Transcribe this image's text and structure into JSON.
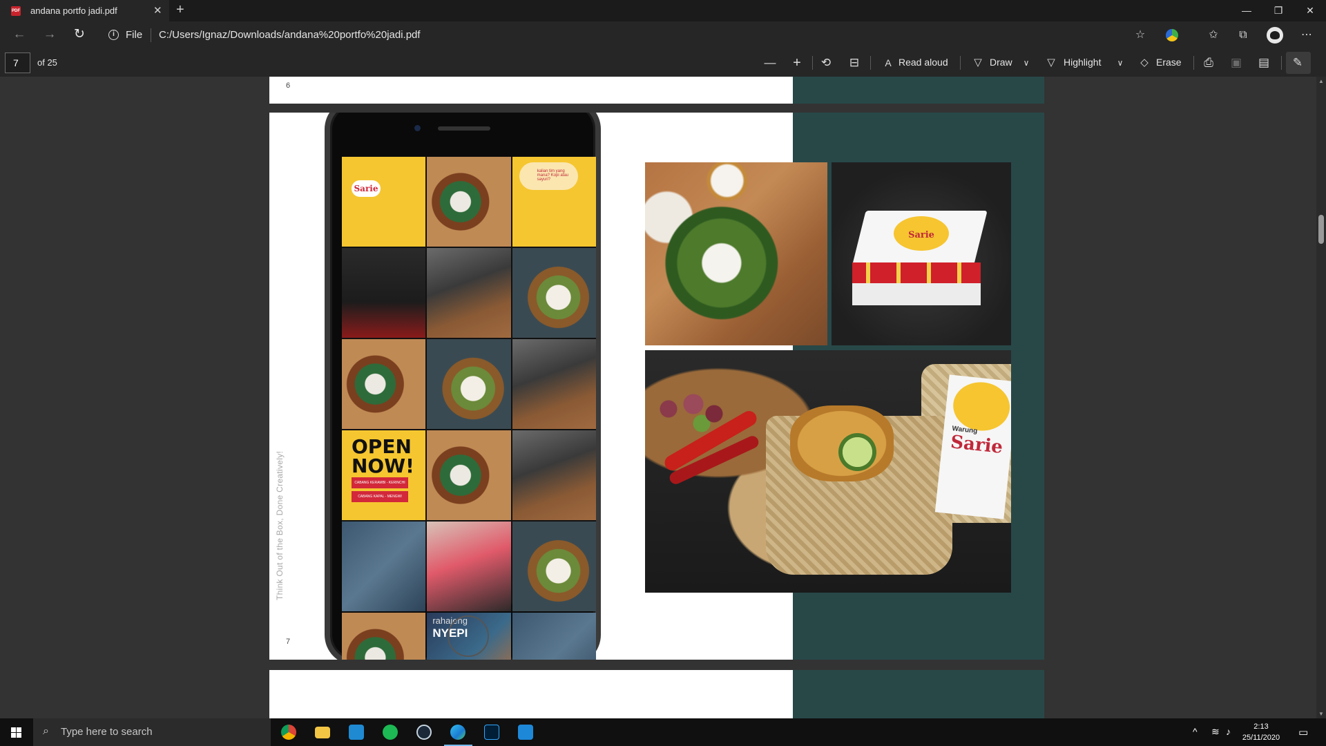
{
  "browser": {
    "tab_title": "andana portfo jadi.pdf",
    "tab_close": "✕",
    "new_tab": "+",
    "window_minimize": "—",
    "window_restore": "❐",
    "window_close": "✕",
    "address_scheme": "File",
    "address_url": "C:/Users/Ignaz/Downloads/andana%20portfo%20jadi.pdf"
  },
  "pdf_toolbar": {
    "current_page": "7",
    "page_count_label": "of 25",
    "read_aloud": "Read aloud",
    "draw": "Draw",
    "highlight": "Highlight",
    "erase": "Erase"
  },
  "document": {
    "page6_number": "6",
    "page7_number": "7",
    "page7_vertical_tagline": "Think Out of the Box, Done Creatively!",
    "phone_grid": {
      "logo_text": "Sarie",
      "bubble_text": "kalian tim yang mana? Kopi atau sayuri?",
      "open_now": "OPEN NOW!",
      "branch_1": "CABANG KERAMBI - KERINCHI",
      "branch_2": "CABANG KAPAL - MENGWI",
      "nyepi_small": "rahajeng",
      "nyepi_big": "NYEPI"
    },
    "box_logo_text": "Sarie",
    "label_warung": "Warung",
    "label_sarie": "Sarie"
  },
  "taskbar": {
    "search_placeholder": "Type here to search",
    "time": "2:13",
    "date": "25/11/2020"
  },
  "colors": {
    "teal_panel": "#284848",
    "brand_yellow": "#f5c630",
    "brand_red": "#d0283a",
    "accent_blue": "#76b9ed"
  }
}
